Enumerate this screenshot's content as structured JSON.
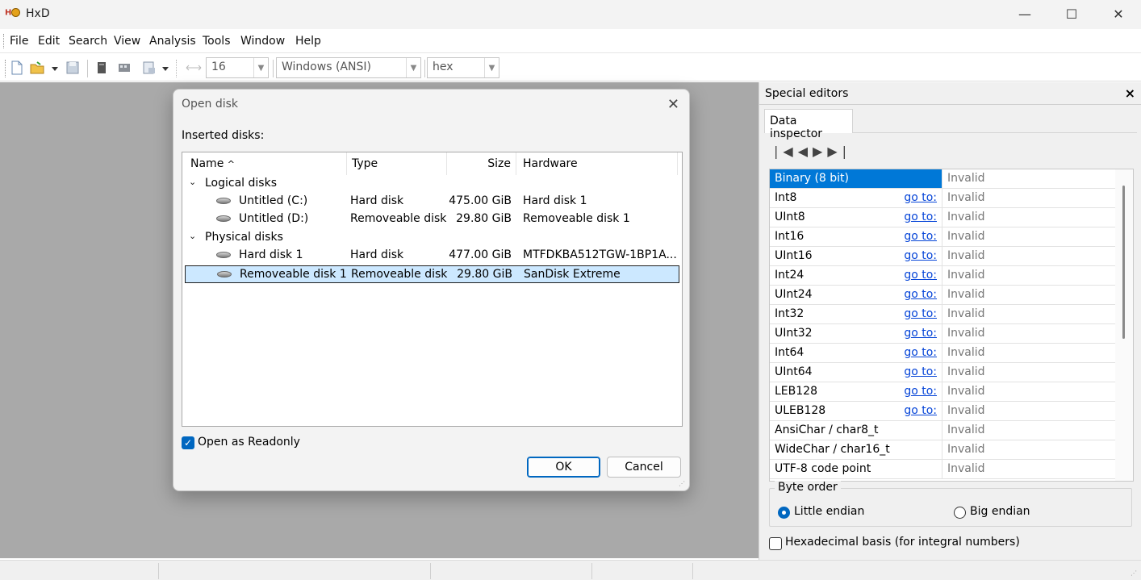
{
  "window": {
    "title": "HxD",
    "minimize": "—",
    "maximize": "☐",
    "close": "✕"
  },
  "menu": [
    "File",
    "Edit",
    "Search",
    "View",
    "Analysis",
    "Tools",
    "Window",
    "Help"
  ],
  "toolbar": {
    "bytes_per_row": "16",
    "charset": "Windows (ANSI)",
    "offset_base": "hex"
  },
  "special_editors": {
    "title": "Special editors",
    "close": "×",
    "tab": "Data inspector",
    "nav": "|◀ ◀ ▶ ▶|",
    "rows": [
      {
        "name": "Binary (8 bit)",
        "goto": "",
        "value": "Invalid"
      },
      {
        "name": "Int8",
        "goto": "go to:",
        "value": "Invalid"
      },
      {
        "name": "UInt8",
        "goto": "go to:",
        "value": "Invalid"
      },
      {
        "name": "Int16",
        "goto": "go to:",
        "value": "Invalid"
      },
      {
        "name": "UInt16",
        "goto": "go to:",
        "value": "Invalid"
      },
      {
        "name": "Int24",
        "goto": "go to:",
        "value": "Invalid"
      },
      {
        "name": "UInt24",
        "goto": "go to:",
        "value": "Invalid"
      },
      {
        "name": "Int32",
        "goto": "go to:",
        "value": "Invalid"
      },
      {
        "name": "UInt32",
        "goto": "go to:",
        "value": "Invalid"
      },
      {
        "name": "Int64",
        "goto": "go to:",
        "value": "Invalid"
      },
      {
        "name": "UInt64",
        "goto": "go to:",
        "value": "Invalid"
      },
      {
        "name": "LEB128",
        "goto": "go to:",
        "value": "Invalid"
      },
      {
        "name": "ULEB128",
        "goto": "go to:",
        "value": "Invalid"
      },
      {
        "name": "AnsiChar / char8_t",
        "goto": "",
        "value": "Invalid"
      },
      {
        "name": "WideChar / char16_t",
        "goto": "",
        "value": "Invalid"
      },
      {
        "name": "UTF-8 code point",
        "goto": "",
        "value": "Invalid"
      }
    ],
    "byte_order": {
      "legend": "Byte order",
      "little": "Little endian",
      "big": "Big endian",
      "selected": "little"
    },
    "hex_basis": {
      "label": "Hexadecimal basis (for integral numbers)",
      "checked": false
    }
  },
  "dialog": {
    "title": "Open disk",
    "close": "✕",
    "inserted_label": "Inserted disks:",
    "columns": {
      "name": "Name",
      "sort": "^",
      "type": "Type",
      "size": "Size",
      "hardware": "Hardware"
    },
    "groups": [
      {
        "label": "Logical disks",
        "expander": "⌄",
        "items": [
          {
            "name": "Untitled (C:)",
            "type": "Hard disk",
            "size": "475.00 GiB",
            "hardware": "Hard disk 1"
          },
          {
            "name": "Untitled (D:)",
            "type": "Removeable disk",
            "size": "29.80 GiB",
            "hardware": "Removeable disk 1"
          }
        ]
      },
      {
        "label": "Physical disks",
        "expander": "⌄",
        "items": [
          {
            "name": "Hard disk 1",
            "type": "Hard disk",
            "size": "477.00 GiB",
            "hardware": "MTFDKBA512TGW-1BP1A..."
          },
          {
            "name": "Removeable disk 1",
            "type": "Removeable disk",
            "size": "29.80 GiB",
            "hardware": "SanDisk Extreme",
            "selected": true
          }
        ]
      }
    ],
    "readonly": {
      "label": "Open as Readonly",
      "checked": true
    },
    "ok": "OK",
    "cancel": "Cancel"
  }
}
